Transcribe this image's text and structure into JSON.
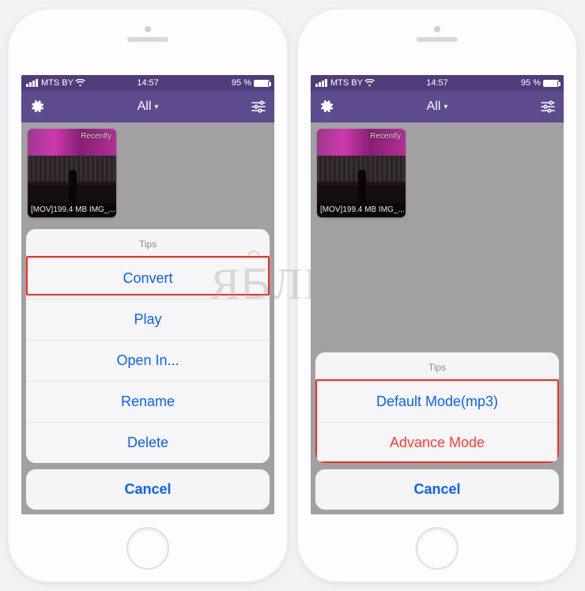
{
  "status": {
    "carrier": "MTS BY",
    "time": "14:57",
    "battery_pct": "95 %"
  },
  "nav": {
    "title": "All"
  },
  "thumb": {
    "badge": "Recently",
    "caption": "[MOV]199.4 MB IMG_..."
  },
  "sheet_left": {
    "header": "Tips",
    "items": [
      {
        "label": "Convert",
        "destructive": false
      },
      {
        "label": "Play",
        "destructive": false
      },
      {
        "label": "Open In...",
        "destructive": false
      },
      {
        "label": "Rename",
        "destructive": false
      },
      {
        "label": "Delete",
        "destructive": false
      }
    ],
    "cancel": "Cancel"
  },
  "sheet_right": {
    "header": "Tips",
    "items": [
      {
        "label": "Default Mode(mp3)",
        "destructive": false
      },
      {
        "label": "Advance Mode",
        "destructive": true
      }
    ],
    "cancel": "Cancel"
  },
  "watermark": "ЯБЛЫК"
}
